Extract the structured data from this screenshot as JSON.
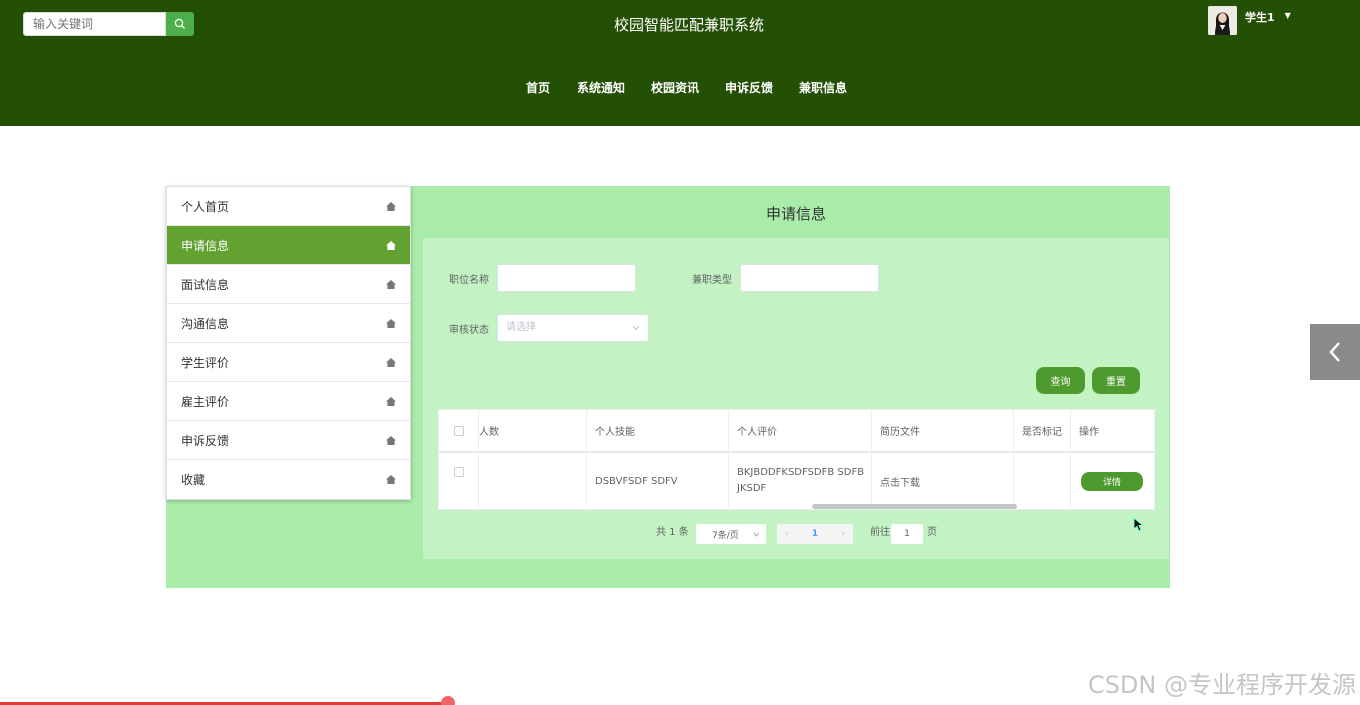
{
  "header": {
    "search_placeholder": "输入关键词",
    "site_title": "校园智能匹配兼职系统",
    "user_name": "学生1",
    "nav": [
      "首页",
      "系统通知",
      "校园资讯",
      "申诉反馈",
      "兼职信息"
    ]
  },
  "sidebar": {
    "items": [
      {
        "label": "个人首页"
      },
      {
        "label": "申请信息"
      },
      {
        "label": "面试信息"
      },
      {
        "label": "沟通信息"
      },
      {
        "label": "学生评价"
      },
      {
        "label": "雇主评价"
      },
      {
        "label": "申诉反馈"
      },
      {
        "label": "收藏"
      }
    ],
    "active_index": 1
  },
  "content": {
    "title": "申请信息",
    "form": {
      "position_label": "职位名称",
      "type_label": "兼职类型",
      "status_label": "审核状态",
      "status_placeholder": "请选择",
      "query_button": "查询",
      "reset_button": "重置"
    },
    "table": {
      "headers": [
        "人数",
        "个人技能",
        "个人评价",
        "简历文件",
        "是否标记",
        "操作"
      ],
      "rows": [
        {
          "count": "",
          "skill": "DSBVFSDF SDFV",
          "evaluation": "BKJBDDFKSDFSDFB SDFBJKSDF",
          "resume": "点击下载",
          "marked": "",
          "action": "详情"
        }
      ]
    },
    "pager": {
      "total": "共 1 条",
      "page_size": "7条/页",
      "current_page": "1",
      "goto_label": "前往",
      "goto_value": "1",
      "page_suffix": "页"
    }
  },
  "watermark": "CSDN @专业程序开发源"
}
